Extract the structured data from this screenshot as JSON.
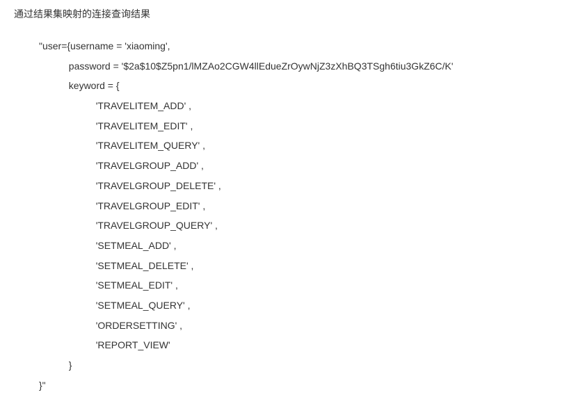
{
  "heading": "通过结果集映射的连接查询结果",
  "code": {
    "line1": "\"user={username = 'xiaoming',",
    "line2": "           password = '$2a$10$Z5pn1/lMZAo2CGW4llEdueZrOywNjZ3zXhBQ3TSgh6tiu3GkZ6C/K'",
    "line3": "           keyword = {",
    "keywords": [
      "'TRAVELITEM_ADD' ,",
      "'TRAVELITEM_EDIT' ,",
      "'TRAVELITEM_QUERY' ,",
      "'TRAVELGROUP_ADD' ,",
      "'TRAVELGROUP_DELETE' ,",
      "'TRAVELGROUP_EDIT' ,",
      "'TRAVELGROUP_QUERY' ,",
      "'SETMEAL_ADD' ,",
      "'SETMEAL_DELETE' ,",
      "'SETMEAL_EDIT' ,",
      "'SETMEAL_QUERY' ,",
      "'ORDERSETTING' ,",
      "'REPORT_VIEW'"
    ],
    "line_close_brace": "           }",
    "line_end": "}\""
  }
}
